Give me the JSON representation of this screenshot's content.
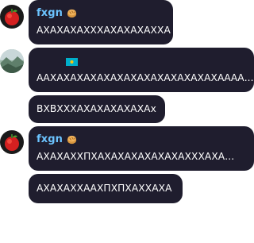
{
  "messages": [
    {
      "author": "fxgn",
      "text": "АХАХАХАХХХАХАХАХАХХА"
    },
    {
      "author": "",
      "text": "ААХАХАХАХАХАХАХАХАХАХАХАХАХАААА..."
    },
    {
      "author": "",
      "text": "ВХВХХХАХАХАХАХАХАх"
    },
    {
      "author": "fxgn",
      "text": "АХАХАХХПХАХАХАХАХАХАХАХХХАХА..."
    },
    {
      "author": "",
      "text": "АХАХАХХААХПХПХАХХАХА"
    }
  ],
  "colors": {
    "bubble": "#1f1d2e",
    "username": "#6cc4ff",
    "text": "#ffffff"
  },
  "icons": {
    "avatar_1": "red-apple-avatar-icon",
    "avatar_2": "landscape-avatar-icon",
    "badge": "bread-emoji-icon",
    "flag": "kazakhstan-flag-icon"
  }
}
